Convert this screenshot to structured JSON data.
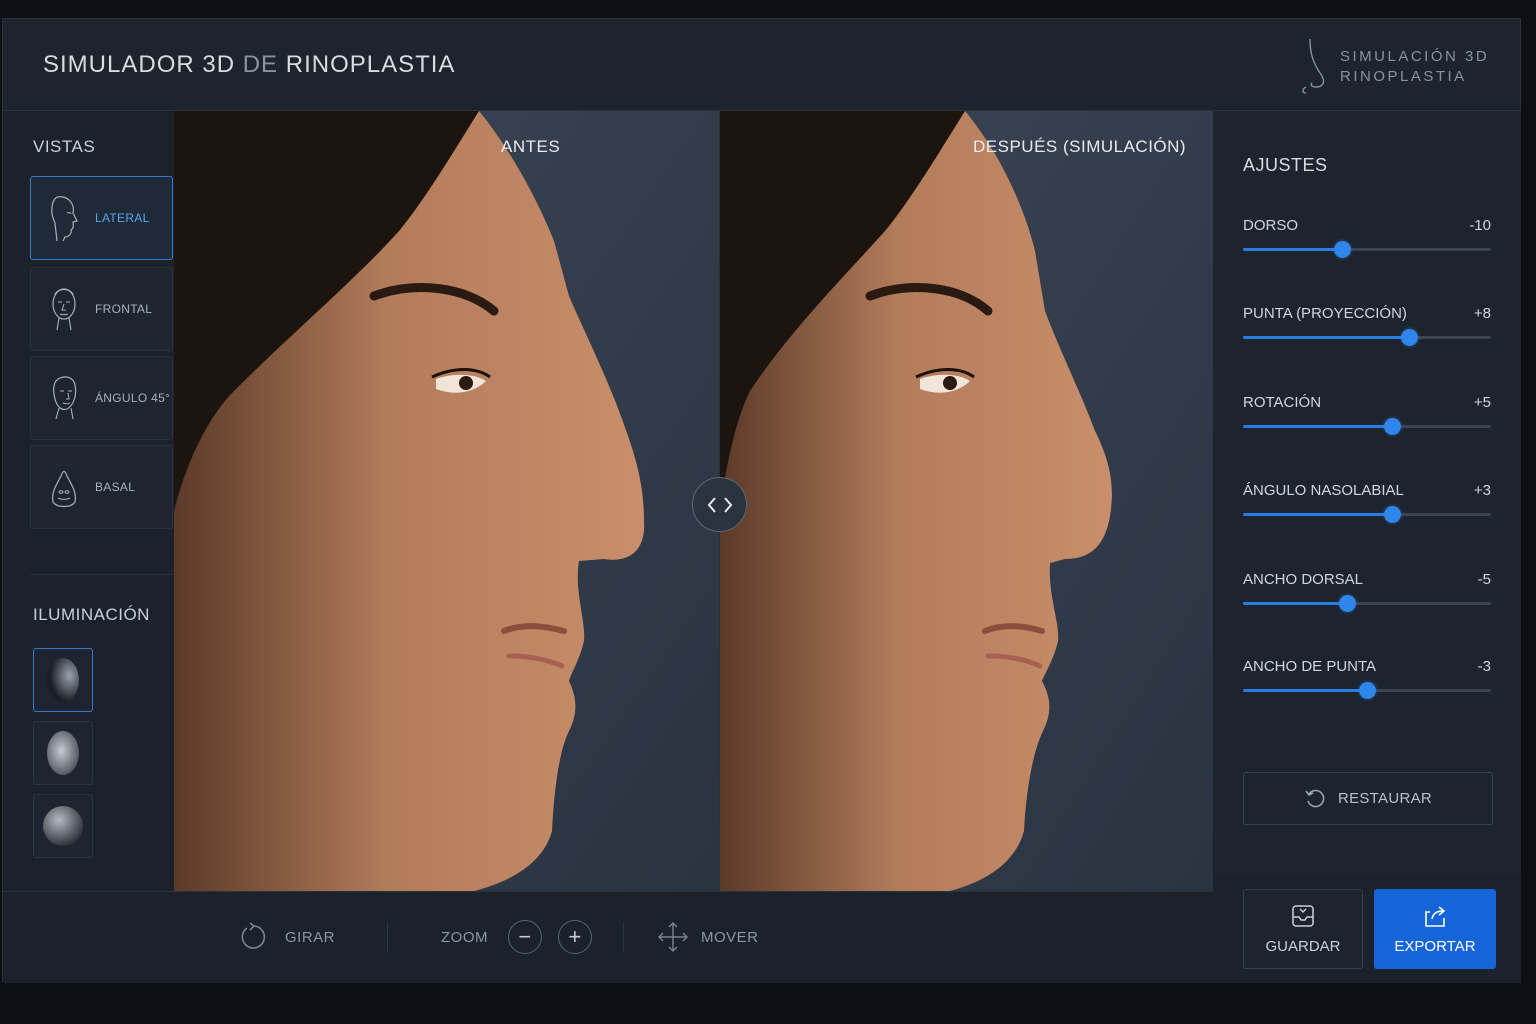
{
  "header": {
    "title_part1": "SIMULADOR 3D",
    "title_part2": "DE",
    "title_part3": "RINOPLASTIA",
    "logo_line1": "SIMULACIÓN 3D",
    "logo_line2": "RINOPLASTIA"
  },
  "sidebar": {
    "views_title": "VISTAS",
    "views": [
      {
        "label": "LATERAL",
        "icon": "face-profile-icon",
        "active": true
      },
      {
        "label": "FRONTAL",
        "icon": "face-front-icon",
        "active": false
      },
      {
        "label": "ÁNGULO 45°",
        "icon": "face-45-icon",
        "active": false
      },
      {
        "label": "BASAL",
        "icon": "face-basal-icon",
        "active": false
      }
    ],
    "lighting_title": "ILUMINACIÓN",
    "lighting": [
      {
        "icon": "lighting-side-icon",
        "active": true
      },
      {
        "icon": "lighting-soft-icon",
        "active": false
      },
      {
        "icon": "lighting-front-icon",
        "active": false
      }
    ]
  },
  "panes": {
    "before_label": "ANTES",
    "after_label": "DESPUÉS (SIMULACIÓN)"
  },
  "adjustments": {
    "title": "AJUSTES",
    "sliders": [
      {
        "name": "DORSO",
        "value": "-10",
        "fraction": 0.4
      },
      {
        "name": "PUNTA (PROYECCIÓN)",
        "value": "+8",
        "fraction": 0.67
      },
      {
        "name": "ROTACIÓN",
        "value": "+5",
        "fraction": 0.6
      },
      {
        "name": "ÁNGULO NASOLABIAL",
        "value": "+3",
        "fraction": 0.6
      },
      {
        "name": "ANCHO DORSAL",
        "value": "-5",
        "fraction": 0.42
      },
      {
        "name": "ANCHO DE PUNTA",
        "value": "-3",
        "fraction": 0.5
      }
    ],
    "restore_label": "RESTAURAR"
  },
  "toolbar": {
    "rotate_label": "GIRAR",
    "zoom_label": "ZOOM",
    "zoom_out": "−",
    "zoom_in": "+",
    "move_label": "MOVER"
  },
  "actions": {
    "save_label": "GUARDAR",
    "export_label": "EXPORTAR"
  },
  "colors": {
    "accent": "#2f86ea",
    "export_bg": "#1565d8",
    "background": "#1b222c"
  }
}
